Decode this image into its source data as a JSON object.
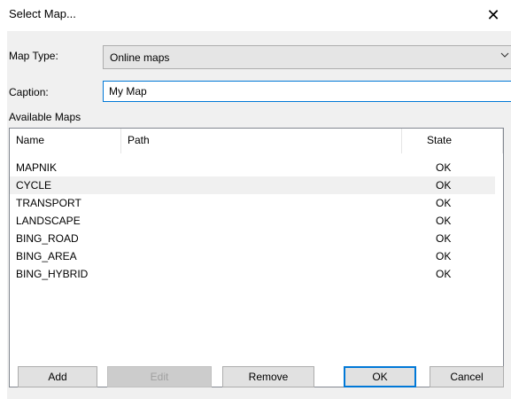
{
  "window": {
    "title": "Select Map...",
    "close_glyph": "✕"
  },
  "map_type": {
    "label": "Map Type:",
    "value": "Online maps"
  },
  "caption": {
    "label": "Caption:",
    "value": "My Map"
  },
  "available_maps": {
    "label": "Available Maps",
    "columns": [
      "Name",
      "Path",
      "State"
    ],
    "rows": [
      {
        "name": "MAPNIK",
        "path": "",
        "state": "OK"
      },
      {
        "name": "CYCLE",
        "path": "",
        "state": "OK"
      },
      {
        "name": "TRANSPORT",
        "path": "",
        "state": "OK"
      },
      {
        "name": "LANDSCAPE",
        "path": "",
        "state": "OK"
      },
      {
        "name": "BING_ROAD",
        "path": "",
        "state": "OK"
      },
      {
        "name": "BING_AREA",
        "path": "",
        "state": "OK"
      },
      {
        "name": "BING_HYBRID",
        "path": "",
        "state": "OK"
      }
    ]
  },
  "buttons": {
    "add": "Add",
    "edit": "Edit",
    "remove": "Remove",
    "ok": "OK",
    "cancel": "Cancel"
  },
  "colors": {
    "focus_border": "#0078d7",
    "dialog_bg": "#f0f0f0",
    "button_bg": "#e1e1e1"
  }
}
